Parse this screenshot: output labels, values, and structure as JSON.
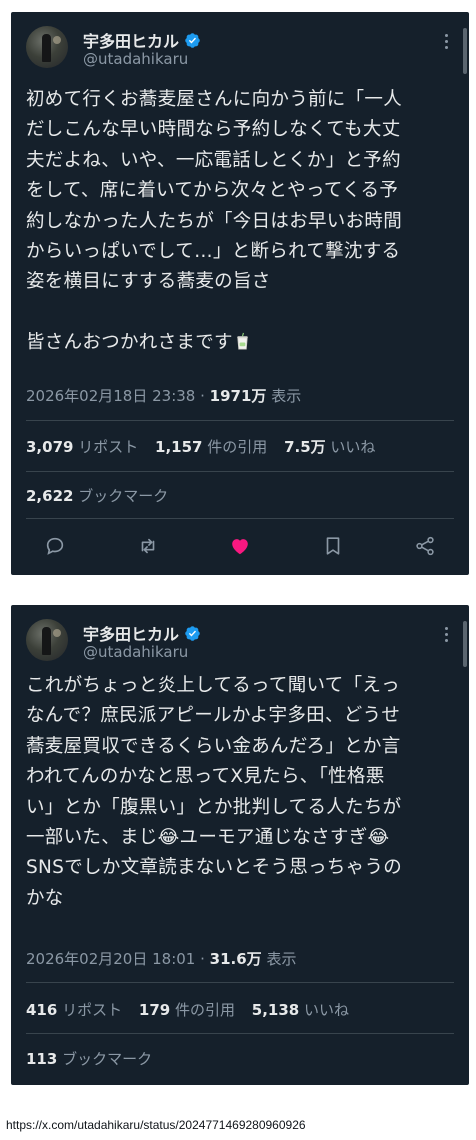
{
  "tweets": [
    {
      "author": {
        "display_name": "宇多田ヒカル",
        "handle": "@utadahikaru"
      },
      "lines": [
        "初めて行くお蕎麦屋さんに向かう前に「一人",
        "だしこんな早い時間なら予約しなくても大丈",
        "夫だよね、いや、一応電話しとくか」と予約",
        "をして、席に着いてから次々とやってくる予",
        "約しなかった人たちが「今日はお早いお時間",
        "からいっぱいでして…」と断られて撃沈する",
        "姿を横目にすする蕎麦の旨さ",
        "",
        "皆さんおつかれさまです"
      ],
      "closing_emoji": "beverage-cup",
      "timestamp": "2026年02月18日 23:38",
      "views_count": "1971万",
      "views_label": "表示",
      "reposts_count": "3,079",
      "reposts_label": "リポスト",
      "quotes_count": "1,157",
      "quotes_label": "件の引用",
      "likes_count": "7.5万",
      "likes_label": "いいね",
      "bookmarks_count": "2,622",
      "bookmarks_label": "ブックマーク",
      "liked": true
    },
    {
      "author": {
        "display_name": "宇多田ヒカル",
        "handle": "@utadahikaru"
      },
      "lines": [
        "これがちょっと炎上してるって聞いて「えっ",
        "なんで？庶民派アピールかよ宇多田、どうせ",
        "蕎麦屋買収できるくらい金あんだろ」とか言",
        "われてんのかなと思ってX見たら、「性格悪",
        "い」とか「腹黒い」とか批判してる人たちが",
        "一部いた、まじ😂ユーモア通じなさすぎ😂",
        "SNSでしか文章読まないとそう思っちゃうの",
        "かな"
      ],
      "timestamp": "2026年02月20日 18:01",
      "views_count": "31.6万",
      "views_label": "表示",
      "reposts_count": "416",
      "reposts_label": "リポスト",
      "quotes_count": "179",
      "quotes_label": "件の引用",
      "likes_count": "5,138",
      "likes_label": "いいね",
      "bookmarks_count": "113",
      "bookmarks_label": "ブックマーク"
    }
  ],
  "source_url": "https://x.com/utadahikaru/status/2024771469280960926",
  "icons": [
    "verified-badge-icon",
    "more-icon",
    "reply-icon",
    "retweet-icon",
    "heart-icon",
    "bookmark-icon",
    "share-icon"
  ],
  "colors": {
    "card_bg": "#15202b",
    "text": "#e7e9ea",
    "muted": "#8b98a5",
    "verified": "#1d9bf0",
    "like": "#f91880",
    "divider": "#38444d"
  }
}
